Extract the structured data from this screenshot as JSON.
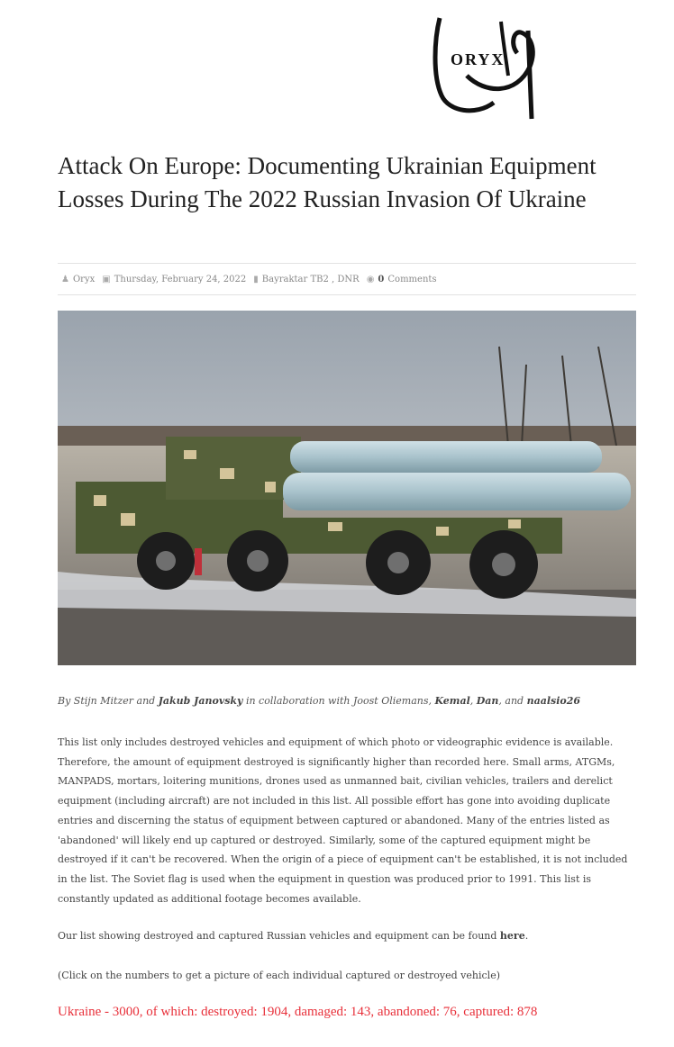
{
  "logo": {
    "text": "ORYX"
  },
  "article": {
    "title": "Attack On Europe: Documenting Ukrainian Equipment Losses During The 2022 Russian Invasion Of Ukraine",
    "meta": {
      "author": "Oryx",
      "date": "Thursday, February 24, 2022",
      "tags": "Bayraktar TB2 , DNR",
      "comments_count": "0",
      "comments_label": "Comments"
    },
    "byline": {
      "prefix": "By Stijn Mitzer and ",
      "name1": "Jakub Janovsky",
      "middle": " in collaboration with Joost Oliemans, ",
      "name2": "Kemal",
      "sep1": ", ",
      "name3": "Dan",
      "sep2": ", and ",
      "name4": "naalsio26"
    },
    "intro": "This list only includes destroyed vehicles and equipment of which photo or videographic evidence is available. Therefore, the amount of equipment destroyed is significantly higher than recorded here. Small arms, ATGMs, MANPADS, mortars, loitering munitions, drones used as unmanned bait, civilian vehicles, trailers and derelict equipment (including aircraft) are not included in this list. All possible effort has gone into avoiding duplicate entries and discerning the status of equipment between captured or abandoned. Many of the entries listed as 'abandoned' will likely end up captured or destroyed. Similarly, some of the captured equipment might be destroyed if it can't be recovered. When the origin of a piece of equipment can't be established, it is not included in the list. The Soviet flag is used when the equipment in question was produced prior to 1991. This list is constantly updated as additional footage becomes available.",
    "russian_list_text": "Our list showing destroyed and captured Russian vehicles and equipment can be found ",
    "russian_list_link": "here",
    "russian_list_end": ".",
    "click_note": "(Click on the numbers to get a picture of each individual captured or destroyed vehicle)",
    "summary": "Ukraine - 3000, of which: destroyed: 1904, damaged: 143, abandoned: 76, captured: 878"
  },
  "colors": {
    "summary": "#e8303a",
    "text": "#444444"
  }
}
